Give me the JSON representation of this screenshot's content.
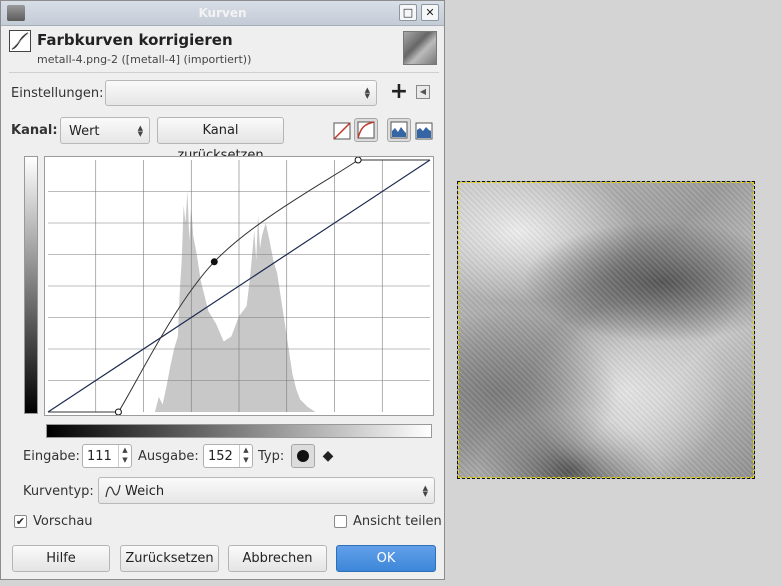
{
  "window": {
    "title": "Kurven"
  },
  "header": {
    "title": "Farbkurven korrigieren",
    "subtitle": "metall-4.png-2 ([metall-4] (importiert))"
  },
  "presets": {
    "label": "Einstellungen:",
    "value": ""
  },
  "channel": {
    "label": "Kanal:",
    "value": "Wert",
    "reset_label": "Kanal zurücksetzen"
  },
  "point": {
    "input_label": "Eingabe:",
    "input_value": "111",
    "output_label": "Ausgabe:",
    "output_value": "152",
    "type_label": "Typ:"
  },
  "curve_type": {
    "label": "Kurventyp:",
    "value": "Weich"
  },
  "preview": {
    "label": "Vorschau",
    "checked": true
  },
  "split_view": {
    "label": "Ansicht teilen",
    "checked": false
  },
  "buttons": {
    "help": "Hilfe",
    "reset": "Zurücksetzen",
    "cancel": "Abbrechen",
    "ok": "OK"
  },
  "icons": {
    "app": "gimp-icon",
    "minimize": "minimize-icon",
    "close": "close-icon",
    "add_preset": "plus-icon",
    "preset_menu": "menu-arrow-icon",
    "linear_histogram": "linear-histogram-icon",
    "log_histogram": "log-histogram-icon",
    "linear_curve": "linear-curve-icon",
    "log_curve": "log-curve-icon",
    "smooth_point": "circle-point-icon",
    "corner_point": "diamond-point-icon"
  },
  "curve": {
    "points": [
      {
        "in": 0,
        "out": 0
      },
      {
        "in": 111,
        "out": 152
      },
      {
        "in": 255,
        "out": 255
      }
    ],
    "control_points": [
      {
        "in": 47,
        "out": 0
      },
      {
        "in": 111,
        "out": 152
      },
      {
        "in": 207,
        "out": 255
      }
    ],
    "selected_point": {
      "in": 111,
      "out": 152
    },
    "range": [
      0,
      255
    ]
  }
}
